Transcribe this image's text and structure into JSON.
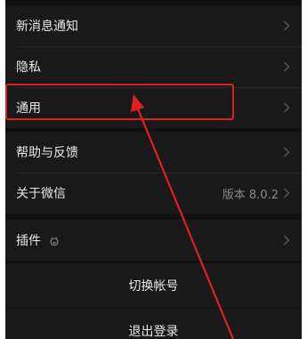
{
  "settings": {
    "group1": [
      {
        "label": "新消息通知"
      },
      {
        "label": "隐私"
      },
      {
        "label": "通用"
      }
    ],
    "group2": [
      {
        "label": "帮助与反馈"
      },
      {
        "label": "关于微信",
        "value": "版本 8.0.2"
      }
    ],
    "group3": [
      {
        "label": "插件"
      }
    ],
    "switch_account": "切换帐号",
    "logout": "退出登录"
  },
  "annotation": {
    "color": "#e0201c"
  }
}
